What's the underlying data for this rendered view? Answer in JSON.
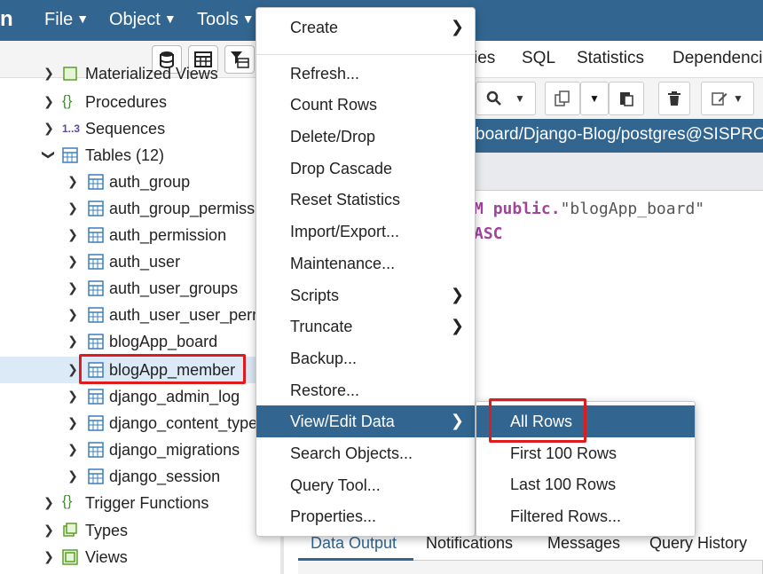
{
  "menubar": {
    "logo": "n",
    "items": [
      {
        "label": "File"
      },
      {
        "label": "Object"
      },
      {
        "label": "Tools"
      }
    ]
  },
  "tree": {
    "items": [
      {
        "label": "Materialized Views"
      },
      {
        "label": "Procedures"
      },
      {
        "label": "Sequences",
        "prefix": "1..3"
      },
      {
        "label": "Tables (12)"
      },
      {
        "label": "auth_group"
      },
      {
        "label": "auth_group_permissions"
      },
      {
        "label": "auth_permission"
      },
      {
        "label": "auth_user"
      },
      {
        "label": "auth_user_groups"
      },
      {
        "label": "auth_user_user_permissions"
      },
      {
        "label": "blogApp_board"
      },
      {
        "label": "blogApp_member"
      },
      {
        "label": "django_admin_log"
      },
      {
        "label": "django_content_type"
      },
      {
        "label": "django_migrations"
      },
      {
        "label": "django_session"
      },
      {
        "label": "Trigger Functions"
      },
      {
        "label": "Types"
      },
      {
        "label": "Views"
      }
    ]
  },
  "tabs": [
    {
      "label": "ies"
    },
    {
      "label": "SQL"
    },
    {
      "label": "Statistics"
    },
    {
      "label": "Dependencies"
    }
  ],
  "path": "board/Django-Blog/postgres@SISPROJ",
  "editor": {
    "line1_kw1": "M",
    "line1_kw2": "public",
    "line1_dot": ".",
    "line1_str": "\"blogApp_board\"",
    "line2_kw": "ASC"
  },
  "bottom_tabs": [
    {
      "label": "Data Output"
    },
    {
      "label": "Notifications"
    },
    {
      "label": "Messages"
    },
    {
      "label": "Query History"
    }
  ],
  "context_menu": {
    "items": [
      {
        "label": "Create",
        "arrow": "❯"
      },
      {
        "label": "Refresh..."
      },
      {
        "label": "Count Rows"
      },
      {
        "label": "Delete/Drop"
      },
      {
        "label": "Drop Cascade"
      },
      {
        "label": "Reset Statistics"
      },
      {
        "label": "Import/Export..."
      },
      {
        "label": "Maintenance..."
      },
      {
        "label": "Scripts",
        "arrow": "❯"
      },
      {
        "label": "Truncate",
        "arrow": "❯"
      },
      {
        "label": "Backup..."
      },
      {
        "label": "Restore..."
      },
      {
        "label": "View/Edit Data",
        "arrow": "❯"
      },
      {
        "label": "Search Objects..."
      },
      {
        "label": "Query Tool..."
      },
      {
        "label": "Properties..."
      }
    ]
  },
  "submenu": {
    "items": [
      {
        "label": "All Rows"
      },
      {
        "label": "First 100 Rows"
      },
      {
        "label": "Last 100 Rows"
      },
      {
        "label": "Filtered Rows..."
      }
    ]
  },
  "colors": {
    "brand": "#326690",
    "highlight": "#e01b1b",
    "selected_row": "#dce9f6"
  }
}
